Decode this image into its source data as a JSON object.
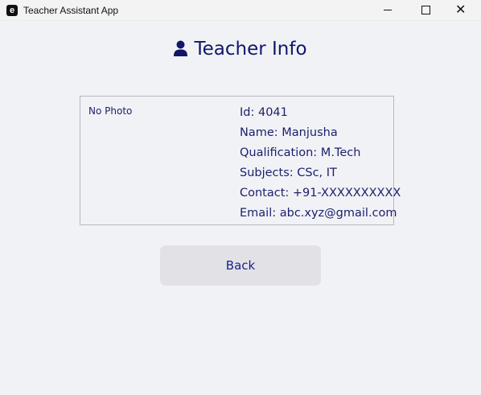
{
  "window": {
    "title": "Teacher Assistant App",
    "icon_letter": "e"
  },
  "window_controls": {
    "close_glyph": "✕"
  },
  "page": {
    "heading": "Teacher Info",
    "heading_icon": "person-icon"
  },
  "card": {
    "photo_placeholder": "No Photo",
    "fields": [
      "Id: 4041",
      "Name: Manjusha",
      "Qualification: M.Tech",
      "Subjects: CSc, IT",
      "Contact: +91-XXXXXXXXXX",
      "Email: abc.xyz@gmail.com"
    ]
  },
  "actions": {
    "back_label": "Back"
  },
  "colors": {
    "text": "#1b1f6b",
    "background": "#f1f2f6",
    "button": "#e2e2e6"
  }
}
